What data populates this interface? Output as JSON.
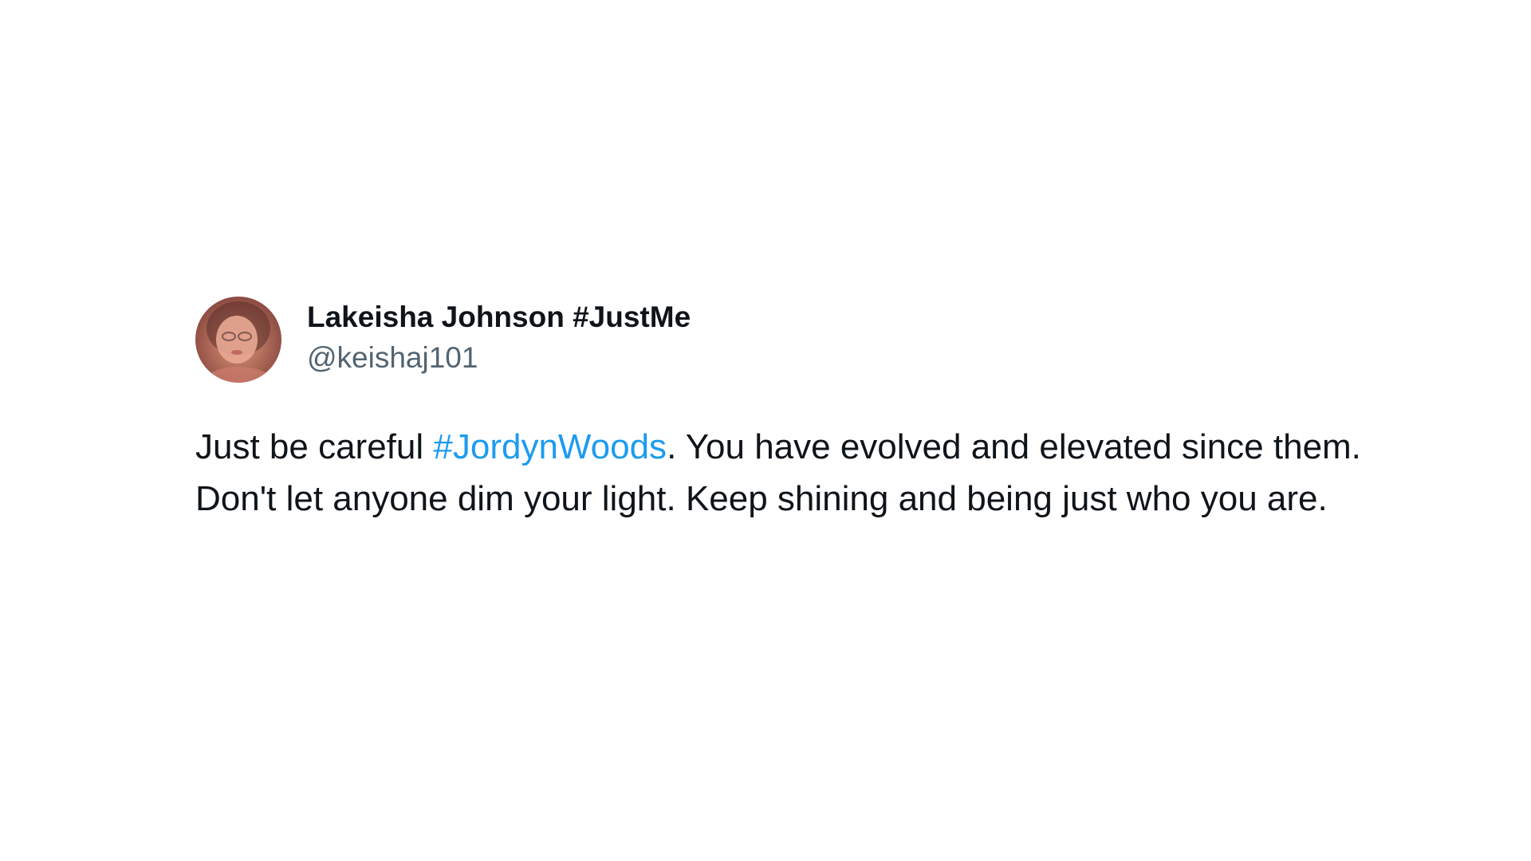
{
  "tweet": {
    "author": {
      "display_name": "Lakeisha Johnson #JustMe",
      "handle": "@keishaj101",
      "avatar_icon": "profile-photo"
    },
    "body": {
      "before_hashtag": "Just be careful ",
      "hashtag": "#JordynWoods",
      "after_hashtag": ". You have evolved and elevated since them. Don't let anyone dim your light. Keep shining and being just who you are."
    }
  },
  "colors": {
    "text_primary": "#0f1419",
    "text_secondary": "#536471",
    "link": "#1d9bf0",
    "background": "#ffffff"
  }
}
